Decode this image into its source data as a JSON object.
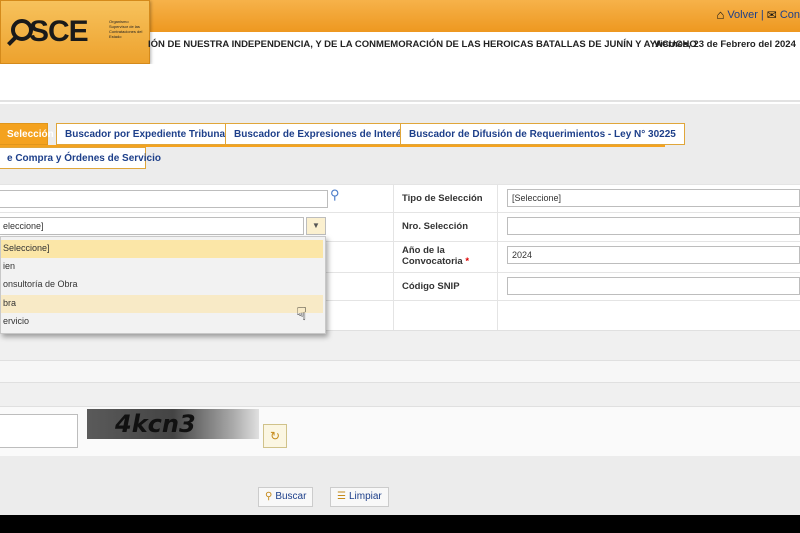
{
  "header": {
    "logo_text": "SCE",
    "logo_subtitle": "Organismo Supervisor de las Contrataciones del Estado",
    "links": [
      {
        "icon": "home-icon",
        "label": "Volver"
      },
      {
        "icon": "mail-icon",
        "label": "Con"
      }
    ],
    "separator": "|",
    "motto": "IÓN DE NUESTRA INDEPENDENCIA, Y DE LA CONMEMORACIÓN DE LAS HEROICAS BATALLAS DE JUNÍN Y AYACUCHO",
    "date": "Viernes, 23 de Febrero del 2024"
  },
  "tabs": [
    {
      "label": "Selección",
      "active": true
    },
    {
      "label": "Buscador por Expediente Tribunal",
      "active": false
    },
    {
      "label": "Buscador de Expresiones de Interés",
      "active": false
    },
    {
      "label": "Buscador de Difusión de Requerimientos - Ley N° 30225",
      "active": false
    },
    {
      "label": "e Compra y Órdenes de Servicio",
      "active": false
    }
  ],
  "form": {
    "left_select_value": "eleccione]",
    "tipo_seleccion_label": "Tipo de Selección",
    "tipo_seleccion_value": "[Seleccione]",
    "nro_seleccion_label": "Nro. Selección",
    "anio_label": "Año de la Convocatoria",
    "required_mark": "*",
    "anio_value": "2024",
    "codigo_snip_label": "Código SNIP"
  },
  "dropdown": {
    "options": [
      "Seleccione]",
      "ien",
      "onsultoría de Obra",
      "bra",
      "ervicio"
    ],
    "selected_index": 0,
    "hover_index": 3
  },
  "captcha": {
    "text": "4kcn3"
  },
  "buttons": {
    "search": "Buscar",
    "clear": "Limpiar"
  },
  "colors": {
    "accent": "#f4a21f",
    "link": "#1d3f8a"
  }
}
